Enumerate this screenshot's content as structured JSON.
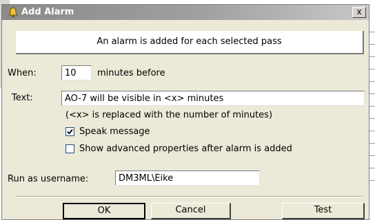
{
  "window": {
    "title": "Add Alarm",
    "close_glyph": "x",
    "title_icon": "bell-icon"
  },
  "info": {
    "message": "An alarm is added for each selected pass"
  },
  "when": {
    "label": "When:",
    "value": "10",
    "suffix": "minutes before"
  },
  "text": {
    "label": "Text:",
    "value": "AO-7 will be visible in <x> minutes",
    "hint": "(<x> is replaced with the number of minutes)"
  },
  "options": {
    "speak_label": "Speak message",
    "speak_checked": true,
    "advanced_label": "Show advanced properties after alarm is added",
    "advanced_checked": false
  },
  "run_as": {
    "label": "Run as username:",
    "value": "DM3ML\\Eike"
  },
  "buttons": {
    "ok": "OK",
    "cancel": "Cancel",
    "test": "Test"
  }
}
